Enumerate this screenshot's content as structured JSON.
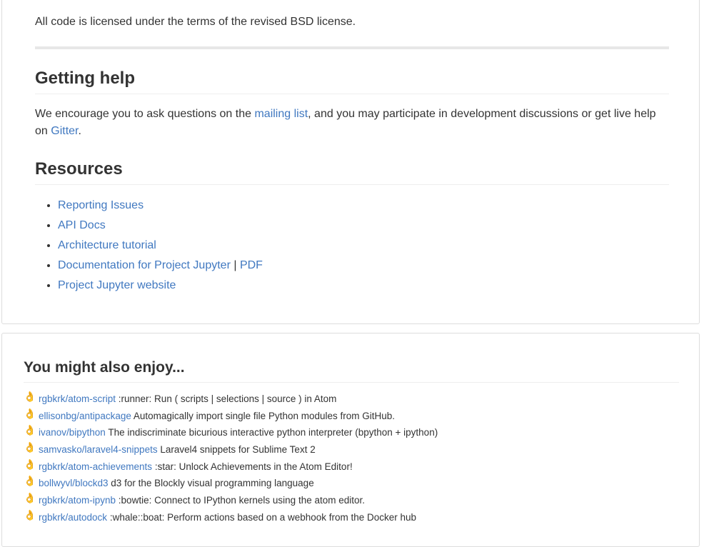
{
  "readme": {
    "license_text": "All code is licensed under the terms of the revised BSD license.",
    "getting_help": {
      "heading": "Getting help",
      "text_before": "We encourage you to ask questions on the ",
      "mailing_list_link": "mailing list",
      "text_middle": ", and you may participate in development discussions or get live help on ",
      "gitter_link": "Gitter",
      "text_after": "."
    },
    "resources": {
      "heading": "Resources",
      "items": [
        {
          "label": "Reporting Issues"
        },
        {
          "label": "API Docs"
        },
        {
          "label": "Architecture tutorial"
        },
        {
          "label": "Documentation for Project Jupyter",
          "separator": " | ",
          "extra_link": "PDF"
        },
        {
          "label": "Project Jupyter website"
        }
      ]
    }
  },
  "related": {
    "heading": "You might also enjoy...",
    "icon": "ok-hand-icon",
    "items": [
      {
        "repo": "rgbkrk/atom-script",
        "description": " :runner: Run ( scripts | selections | source ) in Atom"
      },
      {
        "repo": "ellisonbg/antipackage",
        "description": " Automagically import single file Python modules from GitHub."
      },
      {
        "repo": "ivanov/bipython",
        "description": " The indiscriminate bicurious interactive python interpreter (bpython + ipython)"
      },
      {
        "repo": "samvasko/laravel4-snippets",
        "description": " Laravel4 snippets for Sublime Text 2"
      },
      {
        "repo": "rgbkrk/atom-achievements",
        "description": " :star: Unlock Achievements in the Atom Editor!"
      },
      {
        "repo": "bollwyvl/blockd3",
        "description": " d3 for the Blockly visual programming language"
      },
      {
        "repo": "rgbkrk/atom-ipynb",
        "description": " :bowtie: Connect to IPython kernels using the atom editor."
      },
      {
        "repo": "rgbkrk/autodock",
        "description": " :whale::boat: Perform actions based on a webhook from the Docker hub"
      }
    ]
  },
  "colors": {
    "link": "#4078c0",
    "text": "#333333",
    "icon": "#f0b429"
  }
}
